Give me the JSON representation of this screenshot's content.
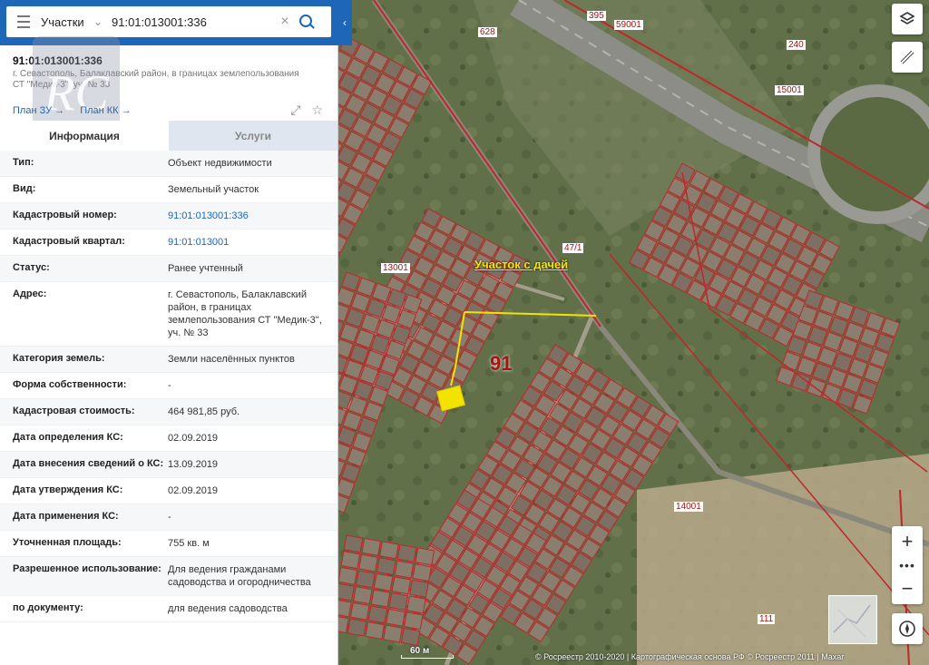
{
  "search": {
    "type_label": "Участки",
    "value": "91:01:013001:336"
  },
  "object": {
    "cadastral_number": "91:01:013001:336",
    "address_header": "г. Севастополь, Балаклавский район, в границах землепользования СТ \"Медик-3\", уч. № 33",
    "plan_zu": "План ЗУ →",
    "plan_kk": "План КК →"
  },
  "logo_text": "RC",
  "tabs": [
    {
      "label": "Информация",
      "active": true
    },
    {
      "label": "Услуги",
      "active": false
    }
  ],
  "info_rows": [
    {
      "key": "Тип:",
      "value": "Объект недвижимости",
      "link": false
    },
    {
      "key": "Вид:",
      "value": "Земельный участок",
      "link": false
    },
    {
      "key": "Кадастровый номер:",
      "value": "91:01:013001:336",
      "link": true
    },
    {
      "key": "Кадастровый квартал:",
      "value": "91:01:013001",
      "link": true
    },
    {
      "key": "Статус:",
      "value": "Ранее учтенный",
      "link": false
    },
    {
      "key": "Адрес:",
      "value": "г. Севастополь, Балаклавский район, в границах землепользования СТ \"Медик-3\", уч. № 33",
      "link": false
    },
    {
      "key": "Категория земель:",
      "value": "Земли населённых пунктов",
      "link": false
    },
    {
      "key": "Форма собственности:",
      "value": "-",
      "link": false
    },
    {
      "key": "Кадастровая стоимость:",
      "value": "464 981,85 руб.",
      "link": false
    },
    {
      "key": "Дата определения КС:",
      "value": "02.09.2019",
      "link": false
    },
    {
      "key": "Дата внесения сведений о КС:",
      "value": "13.09.2019",
      "link": false
    },
    {
      "key": "Дата утверждения КС:",
      "value": "02.09.2019",
      "link": false
    },
    {
      "key": "Дата применения КС:",
      "value": "-",
      "link": false
    },
    {
      "key": "Уточненная площадь:",
      "value": "755 кв. м",
      "link": false
    },
    {
      "key": "Разрешенное использование:",
      "value": "Для ведения гражданами садоводства и огородничества",
      "link": false
    },
    {
      "key": "по документу:",
      "value": "для ведения садоводства",
      "link": false
    }
  ],
  "map": {
    "annotation": "Участок с дачей",
    "quarter_big": "91",
    "quarter_labels": [
      "59001",
      "15001",
      "13001",
      "14001",
      "111",
      "240",
      "395",
      "628",
      "47/1"
    ],
    "scale": "60 м",
    "copyright": "© Росреестр 2010-2020 | Картографическая основа РФ © Росреестр 2011 | Maxar",
    "colors": {
      "parcel_border": "#c0262a",
      "highlight": "#f2e400",
      "road": "#9a9a95"
    }
  },
  "map_controls": {
    "layers_icon": "layers-icon",
    "ruler_icon": "ruler-icon",
    "zoom_in": "+",
    "more": "•••",
    "zoom_out": "−",
    "compass_icon": "compass-icon"
  }
}
